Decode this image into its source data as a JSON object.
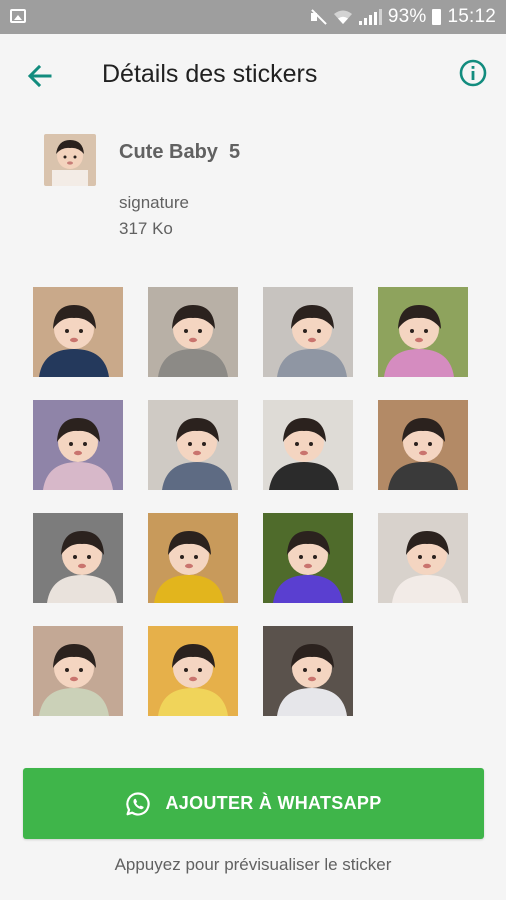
{
  "status_bar": {
    "battery": "93%",
    "time": "15:12",
    "icons": [
      "gallery-notification-icon",
      "mute-icon",
      "wifi-icon",
      "signal-icon",
      "battery-icon"
    ]
  },
  "app_bar": {
    "title": "Détails des stickers",
    "back_icon": "arrow-left-icon",
    "info_icon": "info-circle-icon",
    "accent": "#128c7e"
  },
  "pack": {
    "name": "Cute Baby",
    "number": "5",
    "publisher": "signature",
    "size": "317 Ko"
  },
  "stickers": [
    {
      "bg": "#c9a98a",
      "fg": "#24395c"
    },
    {
      "bg": "#b8b0a6",
      "fg": "#8c8a86"
    },
    {
      "bg": "#c7c3bf",
      "fg": "#8f96a3"
    },
    {
      "bg": "#8ea35d",
      "fg": "#d58cc0"
    },
    {
      "bg": "#8f84a8",
      "fg": "#d7b8c9"
    },
    {
      "bg": "#cfcac4",
      "fg": "#5e6b83"
    },
    {
      "bg": "#dedbd6",
      "fg": "#2b2b2b"
    },
    {
      "bg": "#b38a66",
      "fg": "#3a3a3a"
    },
    {
      "bg": "#7c7c7c",
      "fg": "#e9e2dc"
    },
    {
      "bg": "#c89a5b",
      "fg": "#e2b51d"
    },
    {
      "bg": "#4f6b2b",
      "fg": "#5a3fd0"
    },
    {
      "bg": "#d8d2cc",
      "fg": "#f2ebe7"
    },
    {
      "bg": "#c3a895",
      "fg": "#cbd1b8"
    },
    {
      "bg": "#e6b04a",
      "fg": "#f0d45a"
    },
    {
      "bg": "#5a524c",
      "fg": "#e6e6ea"
    }
  ],
  "add_button": {
    "label": "AJOUTER À WHATSAPP",
    "icon": "whatsapp-icon",
    "color": "#3fb54a"
  },
  "preview_hint": "Appuyez pour prévisualiser le sticker"
}
